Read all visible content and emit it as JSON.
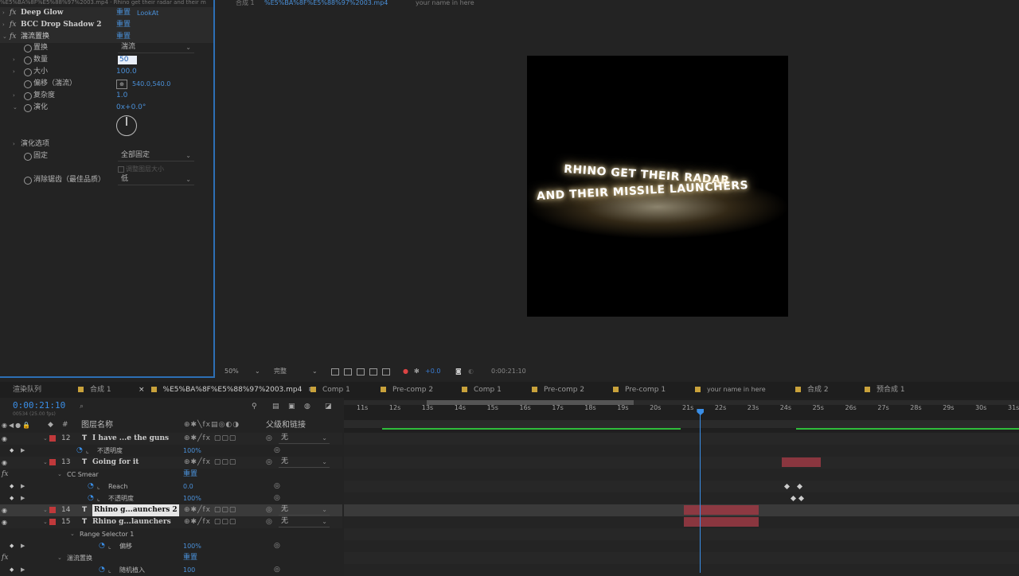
{
  "effect_controls": {
    "top_path": "%E5%BA%8F%E5%88%97%2003.mp4 · Rhino get their radar and their m",
    "rows": [
      {
        "kind": "fx",
        "name": "Deep Glow",
        "reset": "重置",
        "extra": "LookAt"
      },
      {
        "kind": "fx",
        "name": "BCC Drop Shadow 2",
        "reset": "重置",
        "extra": ""
      },
      {
        "kind": "fx",
        "name": "湍流置换",
        "reset": "重置",
        "extra": ""
      },
      {
        "kind": "prop",
        "name": "置换",
        "value": "湍流",
        "type": "dropdown"
      },
      {
        "kind": "prop",
        "name": "数量",
        "value": "50",
        "type": "edit"
      },
      {
        "kind": "prop",
        "name": "大小",
        "value": "100.0",
        "type": "value"
      },
      {
        "kind": "prop",
        "name": "偏移（湍流）",
        "value": "540.0,540.0",
        "type": "point"
      },
      {
        "kind": "prop",
        "name": "复杂度",
        "value": "1.0",
        "type": "value"
      },
      {
        "kind": "prop",
        "name": "演化",
        "value": "0x+0.0°",
        "type": "value"
      }
    ],
    "section": "演化选项",
    "fixed_label": "固定",
    "fixed_value": "全部固定",
    "resize_label": "调整图层大小",
    "antialias_label": "消除锯齿（最佳品质）",
    "antialias_value": "低"
  },
  "viewer": {
    "tabs": [
      "合成 1",
      "%E5%BA%8F%E5%88%97%2003.mp4",
      "your name in here"
    ],
    "line1": "RHINO GET THEIR RADAR",
    "line2": "AND THEIR MISSILE LAUNCHERS",
    "zoom": "50%",
    "quality": "完整",
    "exposure": "+0.0",
    "timecode": "0:00:21:10"
  },
  "panel_tabs": [
    {
      "label": "渲染队列",
      "active": false
    },
    {
      "label": "合成 1",
      "active": false
    },
    {
      "label": "%E5%BA%8F%E5%88%97%2003.mp4",
      "active": true
    },
    {
      "label": "Comp 1",
      "active": false
    },
    {
      "label": "Pre-comp 2",
      "active": false
    },
    {
      "label": "Comp 1",
      "active": false
    },
    {
      "label": "Pre-comp 2",
      "active": false
    },
    {
      "label": "Pre-comp 1",
      "active": false
    },
    {
      "label": "your name in here",
      "active": false
    },
    {
      "label": "合成 2",
      "active": false
    },
    {
      "label": "预合成 1",
      "active": false
    }
  ],
  "timeline": {
    "current_time": "0:00:21:10",
    "fps_note": "00534 (25.00 fps)",
    "search_placeholder": "",
    "col_layer_name": "图层名称",
    "col_parent": "父级和链接",
    "ruler": [
      "11s",
      "12s",
      "13s",
      "14s",
      "15s",
      "16s",
      "17s",
      "18s",
      "19s",
      "20s",
      "21s",
      "22s",
      "23s",
      "24s",
      "25s",
      "26s",
      "27s",
      "28s",
      "29s",
      "30s",
      "31s"
    ],
    "rows": [
      {
        "type": "layer",
        "num": "12",
        "name": "I have ...e the guns",
        "parent": "无"
      },
      {
        "type": "prop",
        "indent": 96,
        "name": "不透明度",
        "value": "100%"
      },
      {
        "type": "layer",
        "num": "13",
        "name": "Going for it",
        "parent": "无"
      },
      {
        "type": "group",
        "indent": 84,
        "name": "CC Smear",
        "value": "重置"
      },
      {
        "type": "prop",
        "indent": 110,
        "name": "Reach",
        "value": "0.0"
      },
      {
        "type": "prop",
        "indent": 110,
        "name": "不透明度",
        "value": "100%"
      },
      {
        "type": "layer",
        "num": "14",
        "name": "Rhino g...aunchers 2",
        "parent": "无",
        "selected": true
      },
      {
        "type": "layer",
        "num": "15",
        "name": "Rhino g...launchers",
        "parent": "无"
      },
      {
        "type": "group",
        "indent": 100,
        "name": "Range Selector 1",
        "value": ""
      },
      {
        "type": "prop",
        "indent": 124,
        "name": "偏移",
        "value": "100%"
      },
      {
        "type": "group",
        "indent": 84,
        "name": "湍流置换",
        "value": "重置"
      },
      {
        "type": "prop",
        "indent": 124,
        "name": "随机植入",
        "value": "100"
      }
    ],
    "playhead_seconds": 21.4
  },
  "colors": {
    "accent": "#2d6fb5",
    "label_red": "#c0393b",
    "work_green": "#2ebd3a"
  }
}
